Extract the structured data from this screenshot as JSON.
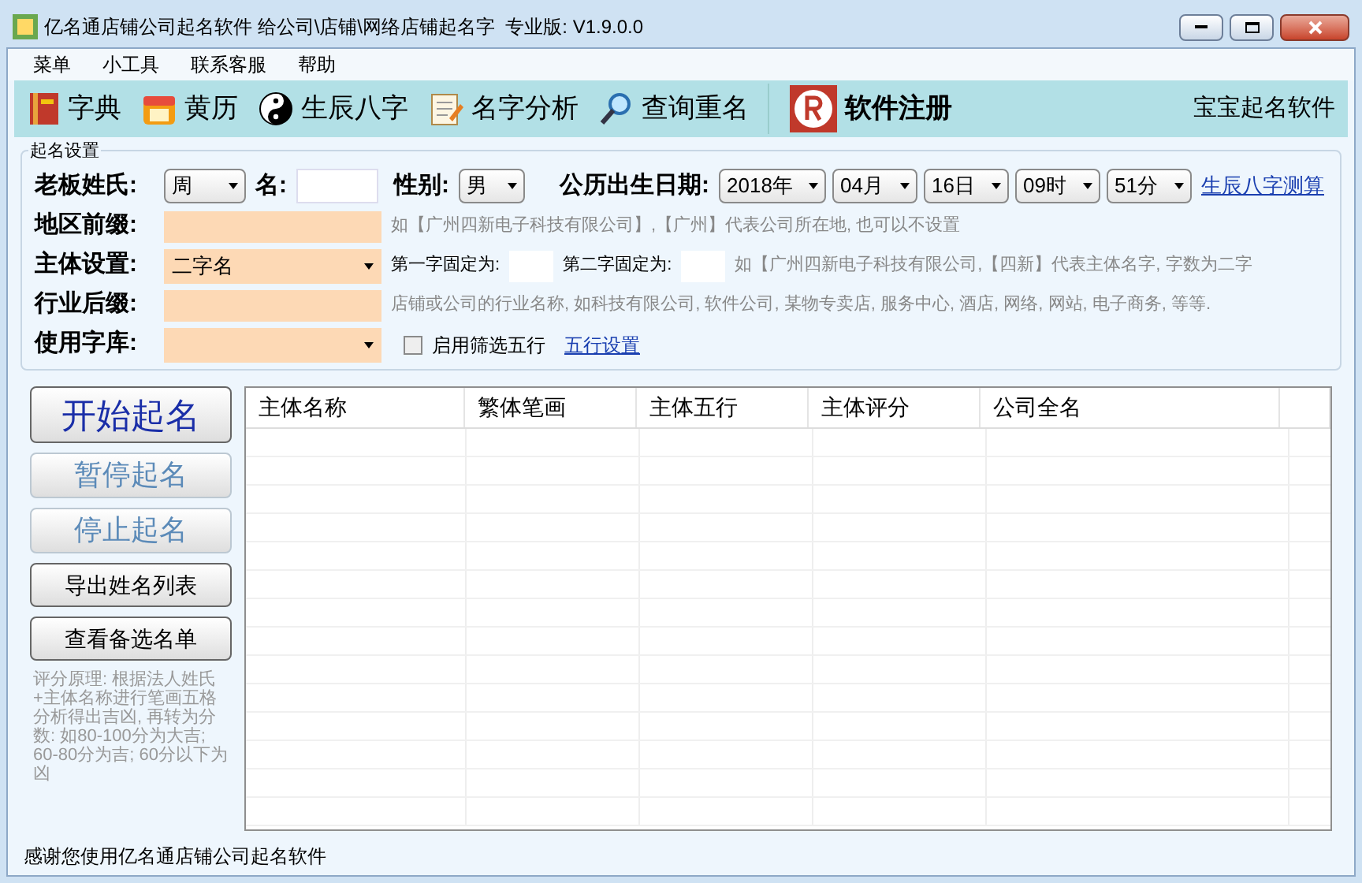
{
  "window": {
    "title": "亿名通店铺公司起名软件 给公司\\店铺\\网络店铺起名字  专业版: V1.9.0.0"
  },
  "menu": [
    "菜单",
    "小工具",
    "联系客服",
    "帮助"
  ],
  "toolbar": [
    {
      "label": "字典",
      "kind": "book"
    },
    {
      "label": "黄历",
      "kind": "calendar"
    },
    {
      "label": "生辰八字",
      "kind": "yinyang"
    },
    {
      "label": "名字分析",
      "kind": "notepad"
    },
    {
      "label": "查询重名",
      "kind": "magnifier"
    },
    {
      "label": "软件注册",
      "kind": "register"
    }
  ],
  "toolbar_right": "宝宝起名软件",
  "settings": {
    "title": "起名设置",
    "surname_label": "老板姓氏:",
    "surname": "周",
    "name_label": "名:",
    "gender_label": "性别:",
    "gender": "男",
    "birth_label": "公历出生日期:",
    "birth": [
      "2018年",
      "04月",
      "16日",
      "09时",
      "51分"
    ],
    "bazi_link": "生辰八字测算",
    "region_label": "地区前缀:",
    "region_hint": "如【广州四新电子科技有限公司】,【广州】代表公司所在地, 也可以不设置",
    "subject_label": "主体设置:",
    "subject": "二字名",
    "first_fixed_label": "第一字固定为:",
    "second_fixed_label": "第二字固定为:",
    "subject_hint": "如【广州四新电子科技有限公司,【四新】代表主体名字, 字数为二字",
    "industry_label": "行业后缀:",
    "industry_hint": "店铺或公司的行业名称, 如科技有限公司, 软件公司, 某物专卖店, 服务中心, 酒店, 网络, 网站, 电子商务, 等等.",
    "library_label": "使用字库:",
    "filter": {
      "label": "启用筛选五行",
      "checked": false
    },
    "wuxing_link": "五行设置"
  },
  "buttons": [
    {
      "label": "开始起名",
      "kind": "primary",
      "disabled": false
    },
    {
      "label": "暂停起名",
      "kind": "primary",
      "disabled": true
    },
    {
      "label": "停止起名",
      "kind": "primary",
      "disabled": true
    },
    {
      "label": "导出姓名列表",
      "kind": "normal",
      "disabled": false
    },
    {
      "label": "查看备选名单",
      "kind": "normal",
      "disabled": false
    }
  ],
  "note": "评分原理: 根据法人姓氏+主体名称进行笔画五格分析得出吉凶, 再转为分数: 如80-100分为大吉; 60-80分为吉; 60分以下为凶",
  "table": {
    "columns": [
      "主体名称",
      "繁体笔画",
      "主体五行",
      "主体评分",
      "公司全名"
    ]
  },
  "status_bar": "感谢您使用亿名通店铺公司起名软件"
}
